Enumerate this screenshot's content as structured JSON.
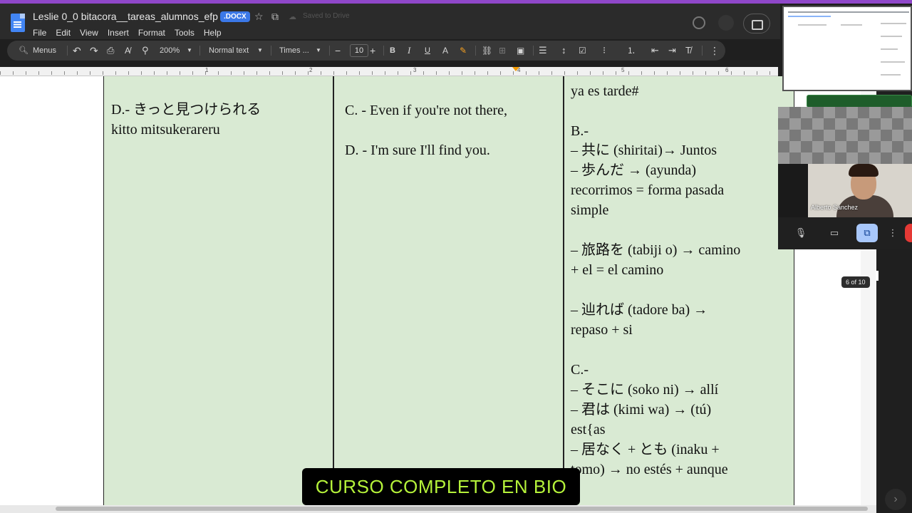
{
  "window": {
    "doc_title": "Leslie 0_0 bitacora__tareas_alumnos_efp",
    "badge": ".DOCX",
    "save_status": "Saved to Drive"
  },
  "menu": [
    "File",
    "Edit",
    "View",
    "Insert",
    "Format",
    "Tools",
    "Help"
  ],
  "toolbar": {
    "menus_label": "Menus",
    "zoom": "200%",
    "style": "Normal text",
    "font": "Times ...",
    "font_size": "10",
    "minus": "−",
    "plus": "+",
    "bold": "B",
    "italic": "I",
    "underline": "U"
  },
  "ruler_marks": [
    "1",
    "2",
    "3",
    "4",
    "5",
    "6"
  ],
  "table": {
    "col1": {
      "line1": "D.- きっと見つけられる",
      "line2": "kitto mitsukerareru"
    },
    "col2": {
      "line1": "C. - Even if you're not there,",
      "line2": "D. - I'm sure I'll find you."
    },
    "col3": {
      "top_partial": "ya es tarde#",
      "b_head": "B.-",
      "b1": "– 共に (shiritai)→ Juntos",
      "b2": "– 歩んだ → (ayunda)",
      "b3": "recorrimos = forma pasada",
      "b4": "simple",
      "b5": "– 旅路を (tabiji o) → camino",
      "b6": "+ el = el camino",
      "b7": "– 辿れば (tadore ba) →",
      "b8": "repaso + si",
      "c_head": "C.-",
      "c1": "– そこに (soko ni) → allí",
      "c2": "– 君は (kimi wa) → (tú)",
      "c3": "est{as",
      "c4": "– 居なく + とも (inaku +",
      "c5": "tomo) → no estés + aunque"
    }
  },
  "page_indicator": "6 of 10",
  "meet": {
    "participant": "Alberto Sanchez"
  },
  "caption": "CURSO COMPLETO EN BIO",
  "colors": {
    "table_bg": "#d9ead3",
    "accent_purple": "#8f47c9",
    "caption_text": "#b5f23a"
  }
}
